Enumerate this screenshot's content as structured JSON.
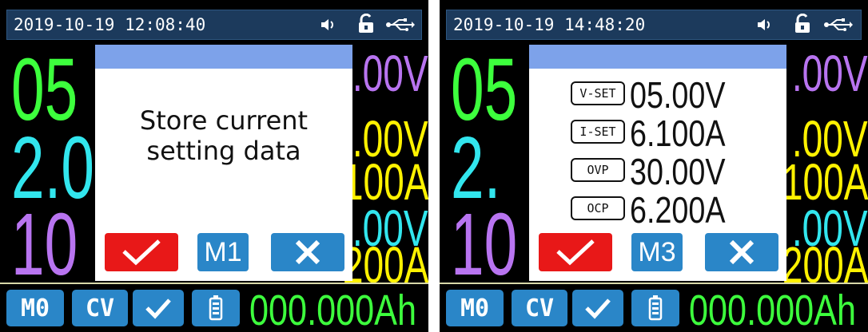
{
  "left": {
    "datetime": "2019-10-19  12:08:40",
    "main_values": {
      "voltage_partial": "05",
      "current_partial": "2.0",
      "power_partial": "10"
    },
    "side_values": {
      "set_voltage_partial": ".00V",
      "ovp_partial": ".00V",
      "ocp_partial": "100A",
      "extra_voltage_partial": ".00V",
      "extra_current_partial": "200A"
    },
    "bottom": {
      "memory": "M0",
      "mode": "CV",
      "energy": "000.000Ah"
    },
    "dialog": {
      "message_line1": "Store current",
      "message_line2": "setting data",
      "memory_button": "M1"
    }
  },
  "right": {
    "datetime": "2019-10-19  14:48:20",
    "main_values": {
      "voltage_partial": "05",
      "current_partial": "2.",
      "power_partial": "10"
    },
    "side_values": {
      "set_voltage_partial": ".00V",
      "ovp_partial": ".00V",
      "ocp_partial": "100A",
      "extra_voltage_partial": ".00V",
      "extra_current_partial": "200A"
    },
    "bottom": {
      "memory": "M0",
      "mode": "CV",
      "energy": "000.000Ah"
    },
    "dialog": {
      "settings": [
        {
          "tag": "V-SET",
          "value": "05.00V"
        },
        {
          "tag": "I-SET",
          "value": "6.100A"
        },
        {
          "tag": "OVP",
          "value": "30.00V"
        },
        {
          "tag": "OCP",
          "value": "6.200A"
        }
      ],
      "memory_button": "M3"
    }
  },
  "icons": {
    "sound": "speaker-icon",
    "lock": "unlock-icon",
    "usb": "usb-icon",
    "confirm": "check-icon",
    "cancel": "close-icon",
    "battery": "battery-icon"
  },
  "colors": {
    "voltage": "#3dff3d",
    "current": "#32e6ee",
    "power": "#b874f0",
    "limit": "#fff200",
    "accent_blue": "#2a86c8",
    "confirm_red": "#e81818",
    "dialog_header": "#7da2ea"
  }
}
